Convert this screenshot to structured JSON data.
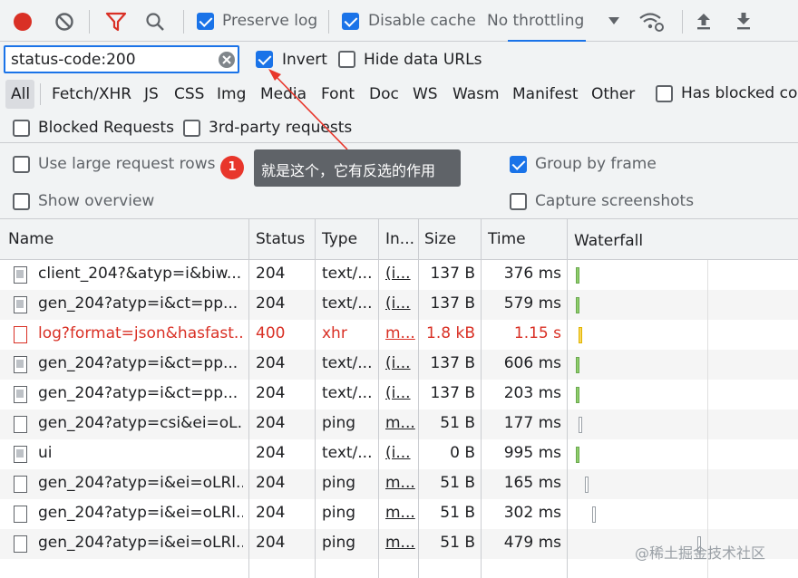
{
  "toolbar": {
    "preserve_log": "Preserve log",
    "disable_cache": "Disable cache",
    "throttling": "No throttling"
  },
  "filter": {
    "value": "status-code:200",
    "invert": "Invert",
    "hide_data_urls": "Hide data URLs",
    "types": [
      "All",
      "Fetch/XHR",
      "JS",
      "CSS",
      "Img",
      "Media",
      "Font",
      "Doc",
      "WS",
      "Wasm",
      "Manifest",
      "Other"
    ],
    "has_blocked": "Has blocked coo",
    "blocked_requests": "Blocked Requests",
    "third_party": "3rd-party requests"
  },
  "settings": {
    "large_rows": "Use large request rows",
    "show_overview": "Show overview",
    "group_by_frame": "Group by frame",
    "capture_screenshots": "Capture screenshots"
  },
  "annotation": {
    "badge": "1",
    "tooltip": "就是这个，它有反选的作用"
  },
  "table": {
    "headers": {
      "name": "Name",
      "status": "Status",
      "type": "Type",
      "initiator": "In...",
      "size": "Size",
      "time": "Time",
      "waterfall": "Waterfall"
    },
    "rows": [
      {
        "name": "client_204?&atyp=i&biw...",
        "status": "204",
        "type": "text/...",
        "initiator": "(i...",
        "size": "137 B",
        "time": "376 ms",
        "icon": "image-file-icon",
        "wf": 0.01,
        "wf_color": "green"
      },
      {
        "name": "gen_204?atyp=i&ct=pp...",
        "status": "204",
        "type": "text/...",
        "initiator": "(i...",
        "size": "137 B",
        "time": "579 ms",
        "icon": "image-file-icon",
        "wf": 0.01,
        "wf_color": "green"
      },
      {
        "name": "log?format=json&hasfast...",
        "status": "400",
        "type": "xhr",
        "initiator": "m...",
        "size": "1.8 kB",
        "time": "1.15 s",
        "icon": "file-icon",
        "wf": 0.02,
        "wf_color": "yellow",
        "error": true
      },
      {
        "name": "gen_204?atyp=i&ct=pp...",
        "status": "204",
        "type": "text/...",
        "initiator": "(i...",
        "size": "137 B",
        "time": "606 ms",
        "icon": "image-file-icon",
        "wf": 0.01,
        "wf_color": "green"
      },
      {
        "name": "gen_204?atyp=i&ct=pp...",
        "status": "204",
        "type": "text/...",
        "initiator": "(i...",
        "size": "137 B",
        "time": "203 ms",
        "icon": "image-file-icon",
        "wf": 0.01,
        "wf_color": "green"
      },
      {
        "name": "gen_204?atyp=csi&ei=oL...",
        "status": "204",
        "type": "ping",
        "initiator": "m...",
        "size": "51 B",
        "time": "177 ms",
        "icon": "file-icon",
        "wf": 0.02,
        "wf_color": "white"
      },
      {
        "name": "ui",
        "status": "204",
        "type": "text/...",
        "initiator": "(i...",
        "size": "0 B",
        "time": "995 ms",
        "icon": "image-file-icon",
        "wf": 0.01,
        "wf_color": "green"
      },
      {
        "name": "gen_204?atyp=i&ei=oLRl...",
        "status": "204",
        "type": "ping",
        "initiator": "m...",
        "size": "51 B",
        "time": "165 ms",
        "icon": "file-icon",
        "wf": 0.05,
        "wf_color": "white"
      },
      {
        "name": "gen_204?atyp=i&ei=oLRl...",
        "status": "204",
        "type": "ping",
        "initiator": "m...",
        "size": "51 B",
        "time": "302 ms",
        "icon": "file-icon",
        "wf": 0.08,
        "wf_color": "white"
      },
      {
        "name": "gen_204?atyp=i&ei=oLRl...",
        "status": "204",
        "type": "ping",
        "initiator": "m...",
        "size": "51 B",
        "time": "479 ms",
        "icon": "file-icon",
        "wf": 0.55,
        "wf_color": "white"
      }
    ]
  },
  "watermark": "@稀土掘金技术社区",
  "colors": {
    "record": "#d93025",
    "filter_active": "#d93025",
    "accent": "#1a73e8",
    "error_text": "#d93025"
  }
}
